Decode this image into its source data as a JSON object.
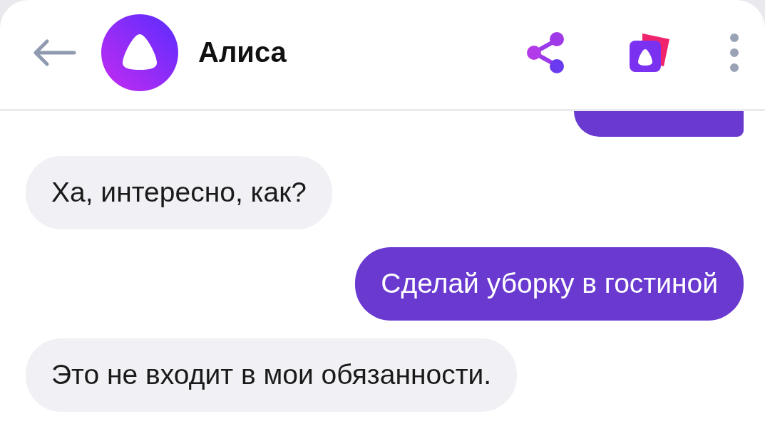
{
  "header": {
    "title": "Алиса"
  },
  "messages": [
    {
      "kind": "user",
      "clipped": true
    },
    {
      "kind": "assistant",
      "clipped": false,
      "text": "Ха, интересно, как?"
    },
    {
      "kind": "user",
      "clipped": false,
      "text": "Сделай уборку в гостиной"
    },
    {
      "kind": "assistant",
      "clipped": false,
      "text": "Это не входит в мои обязанности."
    }
  ]
}
